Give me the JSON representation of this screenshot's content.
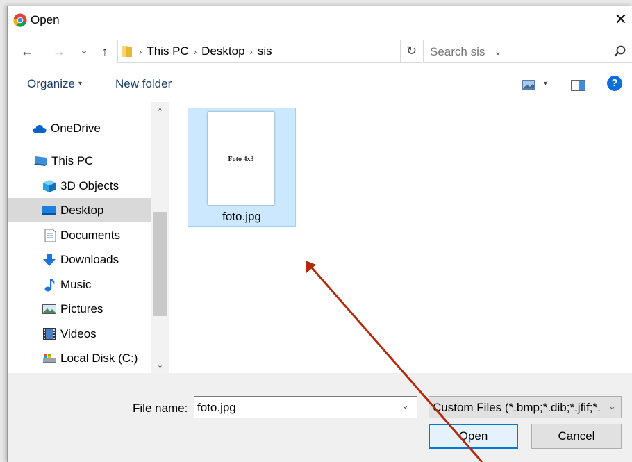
{
  "window": {
    "title": "Open",
    "close_glyph": "✕"
  },
  "navigation": {
    "back_glyph": "←",
    "forward_glyph": "→",
    "recent_glyph": "⌄",
    "up_glyph": "↑",
    "breadcrumb": [
      "This PC",
      "Desktop",
      "sis"
    ],
    "breadcrumb_separator": "›",
    "dropdown_glyph": "⌄",
    "refresh_glyph": "↻",
    "search_placeholder": "Search sis"
  },
  "toolbar": {
    "organize_label": "Organize",
    "new_folder_label": "New folder",
    "help_glyph": "?"
  },
  "sidebar": {
    "items": [
      {
        "label": "OneDrive",
        "icon": "cloud-icon"
      },
      {
        "label": "This PC",
        "icon": "computer-icon"
      },
      {
        "label": "3D Objects",
        "icon": "cube-icon"
      },
      {
        "label": "Desktop",
        "icon": "desktop-icon"
      },
      {
        "label": "Documents",
        "icon": "document-icon"
      },
      {
        "label": "Downloads",
        "icon": "download-arrow-icon"
      },
      {
        "label": "Music",
        "icon": "music-note-icon"
      },
      {
        "label": "Pictures",
        "icon": "picture-icon"
      },
      {
        "label": "Videos",
        "icon": "film-icon"
      },
      {
        "label": "Local Disk (C:)",
        "icon": "disk-icon"
      }
    ],
    "selected": "Desktop",
    "scroll_up_glyph": "^",
    "scroll_down_glyph": "⌄"
  },
  "files": [
    {
      "name": "foto.jpg",
      "thumbnail_text": "Foto 4x3",
      "selected": true
    }
  ],
  "footer": {
    "file_name_label": "File name:",
    "file_name_value": "foto.jpg",
    "filter_value": "Custom Files (*.bmp;*.dib;*.jfif;*.",
    "open_label": "Open",
    "cancel_label": "Cancel",
    "caret_glyph": "⌄"
  },
  "colors": {
    "accent": "#0078d7",
    "selection": "#cce8ff",
    "annotation_arrow": "#b22a0b"
  }
}
